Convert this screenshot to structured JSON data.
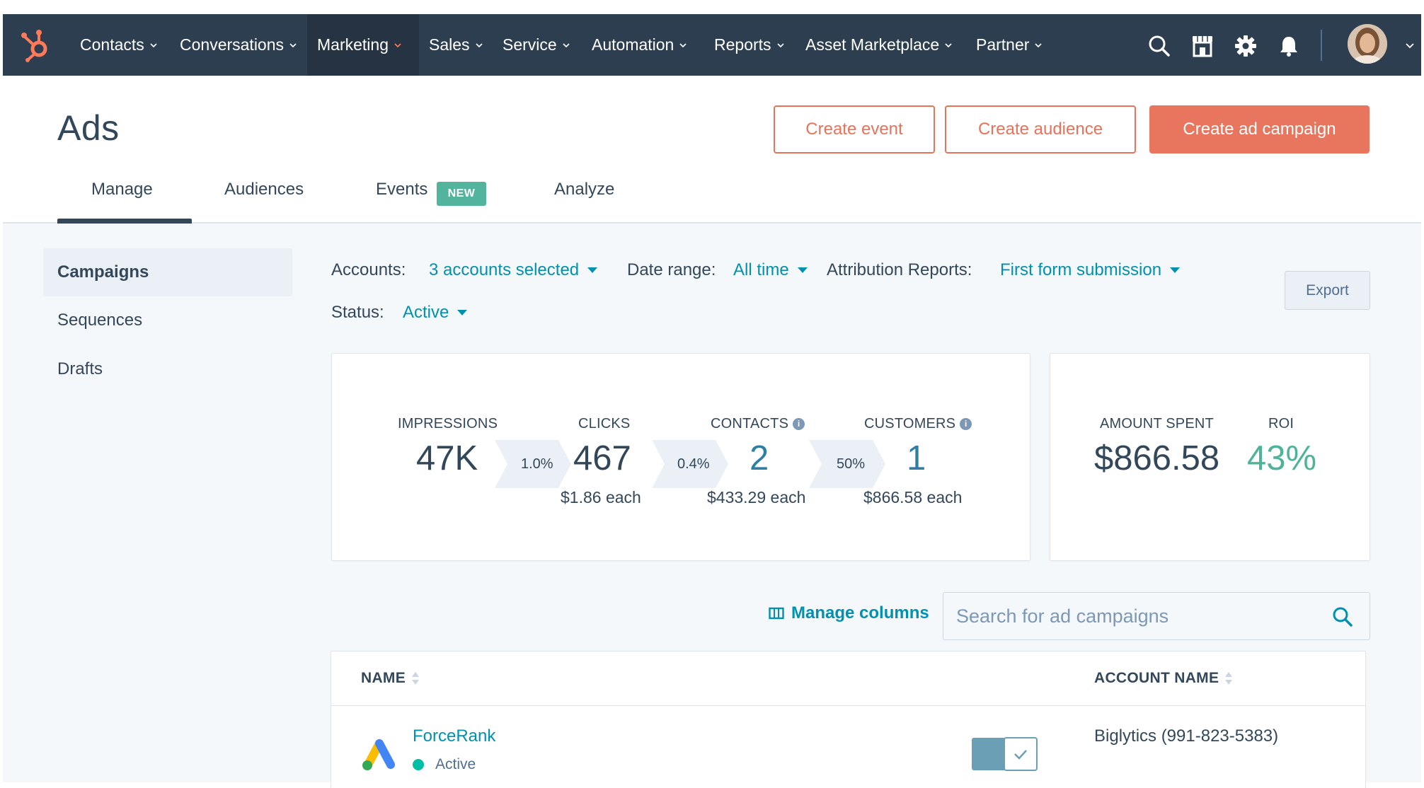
{
  "nav": {
    "items": [
      {
        "label": "Contacts"
      },
      {
        "label": "Conversations"
      },
      {
        "label": "Marketing"
      },
      {
        "label": "Sales"
      },
      {
        "label": "Service"
      },
      {
        "label": "Automation"
      },
      {
        "label": "Reports"
      },
      {
        "label": "Asset Marketplace"
      },
      {
        "label": "Partner"
      }
    ],
    "active_item": "Marketing",
    "icons": [
      "search-icon",
      "marketplace-icon",
      "gear-icon",
      "bell-icon"
    ],
    "colors": {
      "bar": "#2d3e50",
      "active": "#253342",
      "logo": "#ff7a59"
    }
  },
  "header": {
    "title": "Ads",
    "buttons": {
      "create_event": "Create event",
      "create_audience": "Create audience",
      "create_campaign": "Create ad campaign"
    },
    "accent_color": "#e8725a"
  },
  "tabs": [
    {
      "label": "Manage"
    },
    {
      "label": "Audiences"
    },
    {
      "label": "Events"
    },
    {
      "label": "Analyze"
    }
  ],
  "events_badge": "NEW",
  "sidebar": {
    "items": [
      {
        "label": "Campaigns"
      },
      {
        "label": "Sequences"
      },
      {
        "label": "Drafts"
      }
    ]
  },
  "filters": {
    "accounts_label": "Accounts:",
    "accounts_value": "3 accounts selected",
    "date_label": "Date range:",
    "date_value": "All time",
    "attribution_label": "Attribution Reports:",
    "attribution_value": "First form submission",
    "status_label": "Status:",
    "status_value": "Active",
    "export_label": "Export"
  },
  "funnel": {
    "impressions": {
      "label": "IMPRESSIONS",
      "value": "47K"
    },
    "rate1": "1.0%",
    "clicks": {
      "label": "CLICKS",
      "value": "467",
      "sub": "$1.86 each"
    },
    "rate2": "0.4%",
    "contacts": {
      "label": "CONTACTS",
      "value": "2",
      "sub": "$433.29 each"
    },
    "rate3": "50%",
    "customers": {
      "label": "CUSTOMERS",
      "value": "1",
      "sub": "$866.58 each"
    }
  },
  "spend": {
    "amount_label": "AMOUNT SPENT",
    "amount_value": "$866.58",
    "roi_label": "ROI",
    "roi_value": "43%"
  },
  "table_tools": {
    "manage_columns": "Manage columns",
    "search_placeholder": "Search for ad campaigns"
  },
  "table": {
    "columns": [
      {
        "label": "NAME"
      },
      {
        "label": "ACCOUNT NAME"
      }
    ],
    "rows": [
      {
        "name": "ForceRank",
        "status": "Active",
        "account": "Biglytics (991-823-5383)",
        "enabled": true
      }
    ]
  }
}
